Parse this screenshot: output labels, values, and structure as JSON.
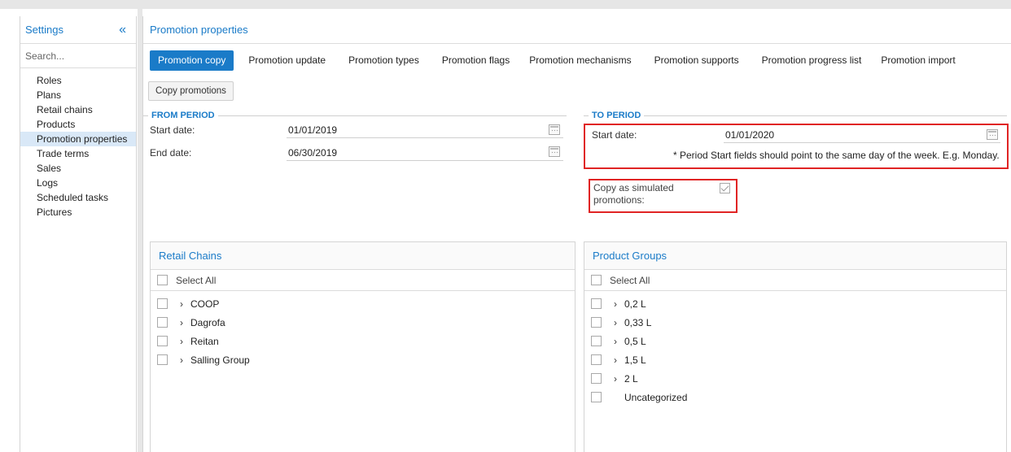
{
  "sidebar": {
    "title": "Settings",
    "collapse_glyph": "«",
    "search_placeholder": "Search...",
    "items": [
      {
        "label": "Roles"
      },
      {
        "label": "Plans"
      },
      {
        "label": "Retail chains"
      },
      {
        "label": "Products"
      },
      {
        "label": "Promotion properties",
        "active": true
      },
      {
        "label": "Trade terms"
      },
      {
        "label": "Sales"
      },
      {
        "label": "Logs"
      },
      {
        "label": "Scheduled tasks"
      },
      {
        "label": "Pictures"
      }
    ]
  },
  "main": {
    "title": "Promotion properties",
    "tabs": [
      {
        "label": "Promotion copy",
        "active": true
      },
      {
        "label": "Promotion update"
      },
      {
        "label": "Promotion types"
      },
      {
        "label": "Promotion flags"
      },
      {
        "label": "Promotion mechanisms"
      },
      {
        "label": "Promotion supports"
      },
      {
        "label": "Promotion progress list"
      },
      {
        "label": "Promotion import"
      }
    ],
    "copy_button": "Copy promotions"
  },
  "from_period": {
    "legend": "FROM PERIOD",
    "start_label": "Start date:",
    "start_value": "01/01/2019",
    "end_label": "End date:",
    "end_value": "06/30/2019"
  },
  "to_period": {
    "legend": "TO PERIOD",
    "start_label": "Start date:",
    "start_value": "01/01/2020",
    "note": "* Period Start fields should point to the same day of the week. E.g. Monday.",
    "simulated_label_line1": "Copy as simulated",
    "simulated_label_line2": "promotions:",
    "simulated_checked": true
  },
  "retail_chains": {
    "title": "Retail Chains",
    "select_all": "Select All",
    "items": [
      {
        "name": "COOP",
        "expandable": true
      },
      {
        "name": "Dagrofa",
        "expandable": true
      },
      {
        "name": "Reitan",
        "expandable": true
      },
      {
        "name": "Salling Group",
        "expandable": true
      }
    ]
  },
  "product_groups": {
    "title": "Product Groups",
    "select_all": "Select All",
    "items": [
      {
        "name": "0,2 L",
        "expandable": true
      },
      {
        "name": "0,33 L",
        "expandable": true
      },
      {
        "name": "0,5 L",
        "expandable": true
      },
      {
        "name": "1,5 L",
        "expandable": true
      },
      {
        "name": "2 L",
        "expandable": true
      },
      {
        "name": "Uncategorized",
        "expandable": false
      }
    ]
  },
  "icons": {
    "chevron": "›",
    "calendar": "calendar-icon"
  },
  "colors": {
    "accent": "#1a7bc8",
    "highlight_box": "#e02424",
    "active_sidebar_bg": "#d9e8f7"
  }
}
